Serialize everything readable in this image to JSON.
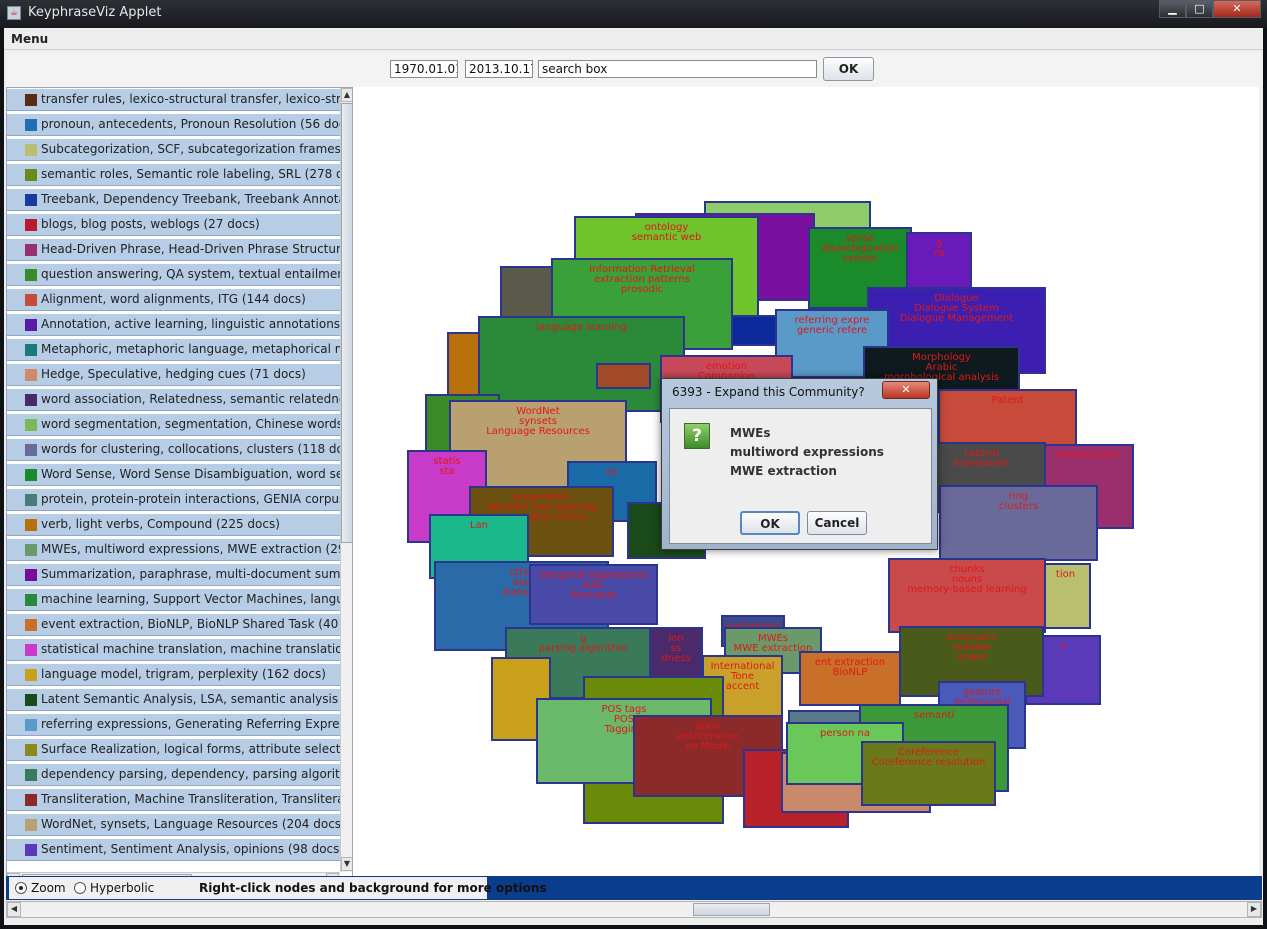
{
  "window": {
    "title": "KeyphraseViz Applet"
  },
  "menu": {
    "label": "Menu"
  },
  "toolbar": {
    "date_from": "1970.01.01.",
    "date_to": "2013.10.17.",
    "search_value": "search box",
    "ok_label": "OK"
  },
  "list": {
    "items": [
      {
        "color": "#5a2a14",
        "label": "transfer rules, lexico-structural transfer, lexico-struc"
      },
      {
        "color": "#1f6fb2",
        "label": "pronoun, antecedents, Pronoun Resolution (56 docs)"
      },
      {
        "color": "#b8c070",
        "label": "Subcategorization, SCF, subcategorization frames (7"
      },
      {
        "color": "#6b8a1e",
        "label": "semantic roles, Semantic role labeling, SRL (278 doc"
      },
      {
        "color": "#1a3aa0",
        "label": "Treebank, Dependency Treebank, Treebank Annota"
      },
      {
        "color": "#b81c2e",
        "label": "blogs, blog posts, weblogs (27 docs)"
      },
      {
        "color": "#9a2f6e",
        "label": "Head-Driven Phrase, Head-Driven Phrase Structure,"
      },
      {
        "color": "#3a8a2a",
        "label": "question answering, QA system, textual entailment ("
      },
      {
        "color": "#c84a3a",
        "label": "Alignment, word alignments, ITG (144 docs)"
      },
      {
        "color": "#5a1aa8",
        "label": "Annotation, active learning, linguistic annotations (2"
      },
      {
        "color": "#1a7a7a",
        "label": "Metaphoric, metaphoric language, metaphorical mea"
      },
      {
        "color": "#d08a6a",
        "label": "Hedge, Speculative, hedging cues (71 docs)"
      },
      {
        "color": "#4a2a6a",
        "label": "word association, Relatedness, semantic relatedness"
      },
      {
        "color": "#7ab85a",
        "label": "word segmentation, segmentation, Chinese words se"
      },
      {
        "color": "#6a6a9a",
        "label": "words for clustering, collocations, clusters (118 doc"
      },
      {
        "color": "#1a8a2a",
        "label": "Word Sense, Word Sense Disambiguation, word sen"
      },
      {
        "color": "#4a7a7a",
        "label": "protein, protein-protein interactions, GENIA corpus ("
      },
      {
        "color": "#b8700a",
        "label": "verb, light verbs, Compound (225 docs)"
      },
      {
        "color": "#6a9a6a",
        "label": "MWEs, multiword expressions, MWE extraction (29 d"
      },
      {
        "color": "#7a0a9a",
        "label": "Summarization, paraphrase, multi-document summa"
      },
      {
        "color": "#2a8a3a",
        "label": "machine learning, Support Vector Machines, languag"
      },
      {
        "color": "#c8702a",
        "label": "event extraction, BioNLP, BioNLP Shared Task (40 d"
      },
      {
        "color": "#c83ac8",
        "label": "statistical machine translation, machine translation,"
      },
      {
        "color": "#c8a01a",
        "label": "language model, trigram, perplexity (162 docs)"
      },
      {
        "color": "#1a4a1a",
        "label": "Latent Semantic Analysis, LSA, semantic analysis (6"
      },
      {
        "color": "#5a9ac8",
        "label": "referring expressions, Generating Referring Express"
      },
      {
        "color": "#8a8a1a",
        "label": "Surface Realization, logical forms, attribute selection"
      },
      {
        "color": "#3a7a5a",
        "label": "dependency parsing, dependency, parsing algorithm"
      },
      {
        "color": "#8a2a2a",
        "label": "Transliteration, Machine Transliteration, Transliterati"
      },
      {
        "color": "#b8a070",
        "label": "WordNet, synsets, Language Resources (204 docs)"
      },
      {
        "color": "#5a3ab8",
        "label": "Sentiment, Sentiment Analysis, opinions (98 docs)"
      }
    ]
  },
  "nodes": [
    {
      "color": "#8fcc6a",
      "lines": []
    },
    {
      "color": "#7a0fa0",
      "lines": []
    },
    {
      "color": "#1a8a2a",
      "lines": [
        "sense",
        "disambiguation",
        "senses"
      ]
    },
    {
      "color": "#6a1ab8",
      "lines": [
        "g",
        "ns"
      ]
    },
    {
      "color": "#6ec42a",
      "lines": [
        "ontology",
        "semantic web"
      ]
    },
    {
      "color": "#5a5a4a",
      "lines": [
        "di",
        "Di"
      ]
    },
    {
      "color": "#3aa03a",
      "lines": [
        "Information Retrieval",
        "extraction patterns",
        "prosodic"
      ]
    },
    {
      "color": "#0a2a9a",
      "lines": []
    },
    {
      "color": "#3c1fb0",
      "lines": [
        "Dialogue",
        "Dialogue System",
        "Dialogue Management"
      ]
    },
    {
      "color": "#5a9ac8",
      "lines": [
        "referring expre",
        "generic refere"
      ]
    },
    {
      "color": "#b8700a",
      "lines": []
    },
    {
      "color": "#2a8a3a",
      "lines": [
        "language learning"
      ]
    },
    {
      "color": "#c84a5a",
      "lines": [
        "emotion",
        "Companion",
        "emotion recognition"
      ]
    },
    {
      "color": "#a04a2a",
      "lines": []
    },
    {
      "color": "#0e1a1e",
      "lines": [
        "Morphology",
        "Arabic",
        "morphological analysis"
      ]
    },
    {
      "color": "#3a8a2a",
      "lines": []
    },
    {
      "color": "#c84a3a",
      "lines": [
        "Patent"
      ]
    },
    {
      "color": "#b8a070",
      "lines": [
        "WordNet",
        "synsets",
        "Language Resources"
      ]
    },
    {
      "color": "#c83ac8",
      "lines": [
        "statis",
        "sta"
      ]
    },
    {
      "color": "#1a6aa8",
      "lines": [
        "on"
      ]
    },
    {
      "color": "#9a2f6e",
      "lines": [
        "Head-Driven"
      ]
    },
    {
      "color": "#4a4a4a",
      "lines": [
        "Lateral",
        "translation"
      ]
    },
    {
      "color": "#6a6a9a",
      "lines": [
        "ring",
        "clusters"
      ]
    },
    {
      "color": "#6b5010",
      "lines": [
        "preposition",
        "decision tree learning",
        "preposition errors"
      ]
    },
    {
      "color": "#1ab88a",
      "lines": [
        "Lan"
      ]
    },
    {
      "color": "#b8c070",
      "lines": [
        "tion"
      ]
    },
    {
      "color": "#c84a4a",
      "lines": [
        "chunks",
        "nouns",
        "memory-based learning"
      ]
    },
    {
      "color": "#1a4a1a",
      "lines": []
    },
    {
      "color": "#2a6aa8",
      "lines": [
        "utter",
        "dial",
        "dialog s"
      ]
    },
    {
      "color": "#4a4aa8",
      "lines": [
        "temporal expressions",
        "AAC",
        "forecasts"
      ]
    },
    {
      "color": "#5a3ab8",
      "lines": [
        "n"
      ]
    },
    {
      "color": "#3a4a8a",
      "lines": [
        "metaphors"
      ]
    },
    {
      "color": "#3a7a5a",
      "lines": [
        "g",
        "parsing algorithm"
      ]
    },
    {
      "color": "#4a2a6a",
      "lines": [
        "ion",
        "ss",
        "dness"
      ]
    },
    {
      "color": "#6a9a6a",
      "lines": [
        "MWEs",
        "MWE extraction"
      ]
    },
    {
      "color": "#c8702a",
      "lines": [
        "ent extraction",
        "BioNLP"
      ]
    },
    {
      "color": "#4a5a1a",
      "lines": [
        "automatic",
        "syllable",
        "vowel"
      ]
    },
    {
      "color": "#c8a01a",
      "lines": []
    },
    {
      "color": "#c8a02a",
      "lines": [
        "International",
        "Tone",
        "accent"
      ]
    },
    {
      "color": "#4a5ab8",
      "lines": [
        "gesture",
        "multimodal",
        "Modality"
      ]
    },
    {
      "color": "#6a8a0a",
      "lines": []
    },
    {
      "color": "#6ab86a",
      "lines": [
        "POS tags",
        "POS",
        "Tagging"
      ]
    },
    {
      "color": "#8a2a2a",
      "lines": [
        "ation",
        "ansliteration",
        "on Model"
      ]
    },
    {
      "color": "#5a7a8a",
      "lines": []
    },
    {
      "color": "#b8202a",
      "lines": []
    },
    {
      "color": "#3a9a3a",
      "lines": [
        "semanti"
      ]
    },
    {
      "color": "#c88a6a",
      "lines": []
    },
    {
      "color": "#6ac85a",
      "lines": [
        "person na"
      ]
    },
    {
      "color": "#6a7a1a",
      "lines": [
        "Coreference",
        "Coreference resolution"
      ]
    }
  ],
  "dialog": {
    "title": "6393 - Expand this Community?",
    "close_icon": "close-icon",
    "lines": [
      "MWEs",
      "multiword expressions",
      "MWE extraction"
    ],
    "ok_label": "OK",
    "cancel_label": "Cancel"
  },
  "bottom": {
    "zoom_label": "Zoom",
    "hyperbolic_label": "Hyperbolic",
    "selected_mode": "Zoom",
    "hint": "Right-click nodes and background for more options"
  }
}
